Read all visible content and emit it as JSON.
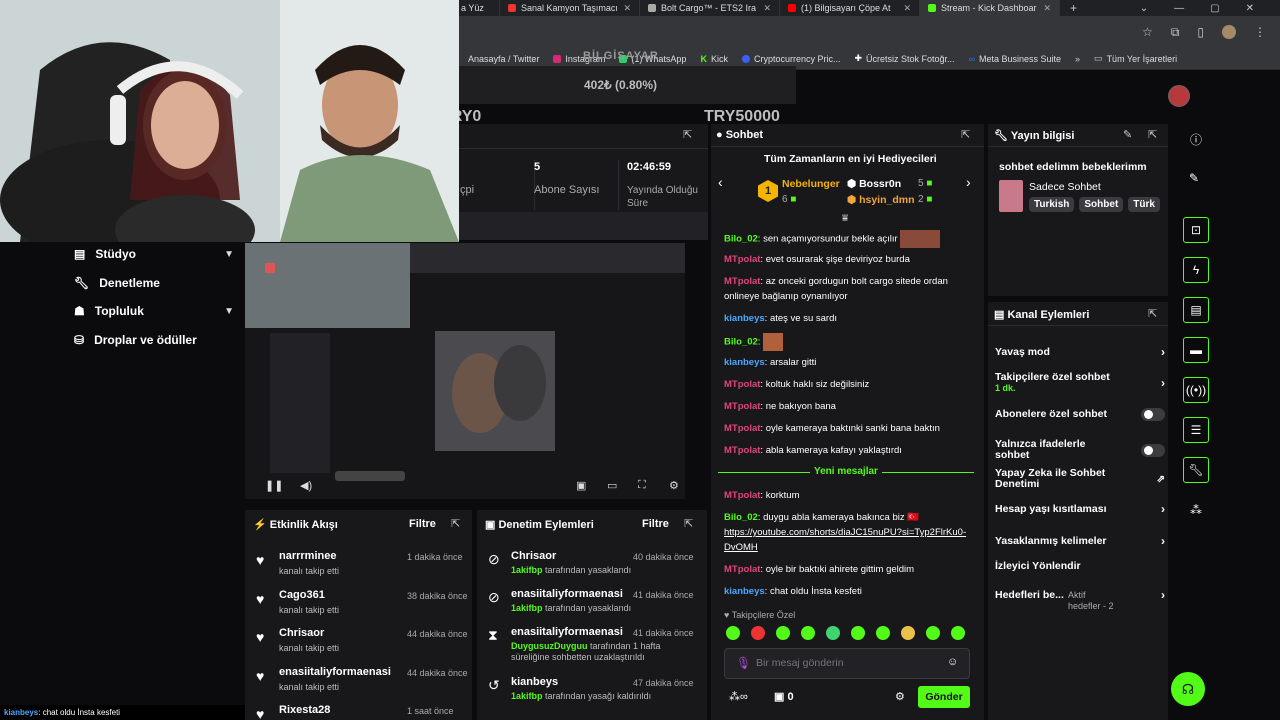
{
  "browser": {
    "tabs": [
      {
        "label": "a Yüz",
        "color": "#888"
      },
      {
        "label": "Sanal Kamyon Taşımacı",
        "color": "#e33"
      },
      {
        "label": "Bolt Cargo™ - ETS2 Ira",
        "color": "#aaa"
      },
      {
        "label": "(1) Bilgisayarı Çöpe At",
        "color": "#f00"
      },
      {
        "label": "Stream - Kick Dashboar",
        "color": "#53fc18"
      }
    ],
    "bookmarks": [
      "Anasayfa / Twitter",
      "Instagram",
      "(1) WhatsApp",
      "Kick",
      "Cryptocurrency Pric...",
      "Ücretsiz Stok Fotoğr...",
      "Meta Business Suite",
      "Tüm Yer İşaretleri"
    ]
  },
  "goal": {
    "title": "BİLGİSAYAR",
    "value": "402₺ (0.80%)",
    "min": "TRY0",
    "max": "TRY50000",
    "progress": 0.008
  },
  "stats": [
    {
      "value": "",
      "label": "çpi"
    },
    {
      "value": "5",
      "label": "Abone Sayısı"
    },
    {
      "value": "02:46:59",
      "label": "Yayında Olduğu Süre"
    }
  ],
  "sidebar": [
    {
      "label": "Stüdyo",
      "icon": "studio-icon",
      "expand": true
    },
    {
      "label": "Denetleme",
      "icon": "wrench-icon",
      "expand": false
    },
    {
      "label": "Topluluk",
      "icon": "community-icon",
      "expand": true
    },
    {
      "label": "Droplar ve ödüller",
      "icon": "gift-icon",
      "expand": false
    }
  ],
  "activity": {
    "title": "Etkinlik Akışı",
    "filter": "Filtre",
    "items": [
      {
        "name": "narrrminee",
        "sub": "kanalı takip etti",
        "time": "1 dakika önce"
      },
      {
        "name": "Cago361",
        "sub": "kanalı takip etti",
        "time": "38 dakika önce"
      },
      {
        "name": "Chrisaor",
        "sub": "kanalı takip etti",
        "time": "44 dakika önce"
      },
      {
        "name": "enasiitaliyformaenasi",
        "sub": "kanalı takip etti",
        "time": "44 dakika önce"
      },
      {
        "name": "Rixesta28",
        "sub": "",
        "time": "1 saat önce"
      }
    ]
  },
  "mod": {
    "title": "Denetim Eylemleri",
    "filter": "Filtre",
    "items": [
      {
        "name": "Chrisaor",
        "actor": "1akifbp",
        "sub": " tarafından yasaklandı",
        "time": "40 dakika önce",
        "icon": "ban-icon"
      },
      {
        "name": "enasiitaliyformaenasi",
        "actor": "1akifbp",
        "sub": " tarafından yasaklandı",
        "time": "41 dakika önce",
        "icon": "ban-icon"
      },
      {
        "name": "enasiitaliyformaenasi",
        "actor": "DuygusuzDuyguu",
        "sub": " tarafından 1 hafta süreliğine sohbetten uzaklaştırıldı",
        "time": "41 dakika önce",
        "icon": "hourglass-icon"
      },
      {
        "name": "kianbeys",
        "actor": "1akifbp",
        "sub": " tarafından yasağı kaldırıldı",
        "time": "47 dakika önce",
        "icon": "undo-icon"
      }
    ]
  },
  "chat": {
    "title": "Sohbet",
    "gifters_title": "Tüm Zamanların en iyi Hediyecileri",
    "gifters": [
      {
        "rank": "1",
        "name": "Nebelunger",
        "count": "6"
      },
      {
        "name": "Bossr0n",
        "count": "5"
      },
      {
        "name": "hsyin_dmn",
        "count": "2"
      }
    ],
    "new_messages": "Yeni mesajlar",
    "messages": [
      {
        "user": "Bilo_02",
        "color": "#53fc18",
        "text": "sen açamıyorsundur bekle açılır"
      },
      {
        "user": "MTpolat",
        "color": "#e0447a",
        "text": "evet osurarak şişe deviriyoz burda"
      },
      {
        "user": "MTpolat",
        "color": "#e0447a",
        "text": "az onceki gordugun bolt cargo sitede ordan onlineye bağlanıp oynanılıyor"
      },
      {
        "user": "kianbeys",
        "color": "#4aa8ff",
        "text": "ateş ve su sardı"
      },
      {
        "user": "Bilo_02",
        "color": "#53fc18",
        "text": ""
      },
      {
        "user": "kianbeys",
        "color": "#4aa8ff",
        "text": "arsalar gitti"
      },
      {
        "user": "MTpolat",
        "color": "#e0447a",
        "text": "koltuk haklı siz değilsiniz"
      },
      {
        "user": "MTpolat",
        "color": "#e0447a",
        "text": "ne bakıyon bana"
      },
      {
        "user": "MTpolat",
        "color": "#e0447a",
        "text": "oyle kameraya baktınki sanki bana baktın"
      },
      {
        "user": "MTpolat",
        "color": "#e0447a",
        "text": "abla kameraya kafayı yaklaştırdı"
      },
      {
        "user": "MTpolat",
        "color": "#e0447a",
        "text": "korktum"
      },
      {
        "user": "Bilo_02",
        "color": "#53fc18",
        "text": "duygu abla kameraya bakınca biz 🇹🇷"
      },
      {
        "user": "MTpolat",
        "color": "#e0447a",
        "text": "oyle bir baktıki ahirete gittim geldim"
      },
      {
        "user": "kianbeys",
        "color": "#4aa8ff",
        "text": "chat oldu İnsta kesfeti"
      }
    ],
    "link": "https://youtube.com/shorts/diaJC15nuPU?si=Typ2FlrKu0-DvOMH",
    "followers_only": "Takipçilere Özel",
    "placeholder": "Bir mesaj gönderin",
    "points": "0",
    "send": "Gönder"
  },
  "stream_info": {
    "title": "Yayın bilgisi",
    "stream_title": "sohbet edelimm bebeklerimm",
    "category": "Sadece Sohbet",
    "tags": [
      "Turkish",
      "Sohbet",
      "Türk"
    ]
  },
  "channel_actions": {
    "title": "Kanal Eylemleri",
    "items": [
      {
        "label": "Yavaş mod",
        "type": "chev"
      },
      {
        "label": "Takipçilere özel sohbet",
        "sub": "1 dk.",
        "type": "chev"
      },
      {
        "label": "Abonelere özel sohbet",
        "type": "toggle"
      },
      {
        "label": "Yalnızca ifadelerle sohbet",
        "type": "toggle"
      },
      {
        "label": "Yapay Zeka ile Sohbet Denetimi",
        "type": "ext"
      },
      {
        "label": "Hesap yaşı kısıtlaması",
        "type": "chev"
      },
      {
        "label": "Yasaklanmış kelimeler",
        "type": "chev"
      },
      {
        "label": "İzleyici Yönlendir",
        "type": "none"
      },
      {
        "label": "Hedefleri be...",
        "sub": "Aktif hedefler - 2",
        "type": "chev"
      }
    ]
  },
  "overlay_caption": {
    "user": "kianbeys",
    "text": ": chat oldu İnsta kesfeti"
  },
  "colors": {
    "accent": "#53fc18",
    "panel": "#18181b",
    "bg": "#0b0b0d"
  }
}
